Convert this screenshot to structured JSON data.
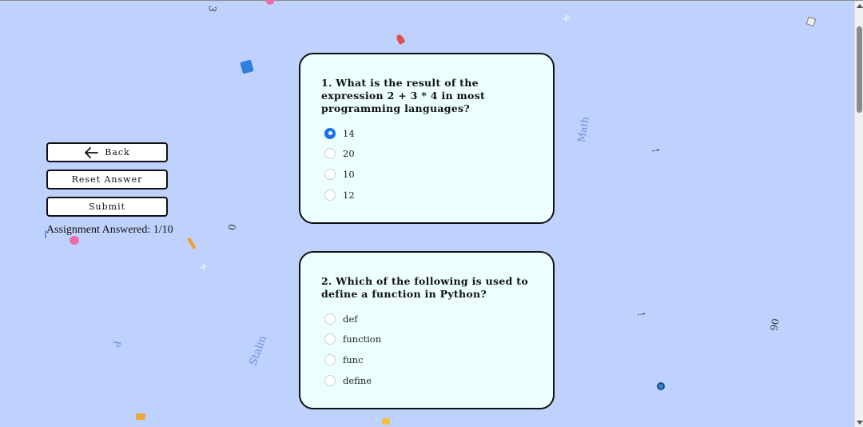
{
  "side_panel": {
    "back_label": "Back",
    "reset_label": "Reset Answer",
    "submit_label": "Submit",
    "answered_text": "Assignment Answered: 1/10"
  },
  "questions": [
    {
      "text": "1. What is the result of the expression 2 + 3 * 4 in most programming languages?",
      "options": [
        "14",
        "20",
        "10",
        "12"
      ],
      "selected_index": 0
    },
    {
      "text": "2. Which of the following is used to define a function in Python?",
      "options": [
        "def",
        "function",
        "func",
        "define"
      ],
      "selected_index": null
    }
  ],
  "background_glyphs": [
    "3",
    "0",
    "P",
    "Stalin",
    "Math",
    "!",
    "!",
    "90",
    "x",
    "x"
  ],
  "colors": {
    "background": "#bfd2fd",
    "card": "#ecfffe",
    "radio_selected": "#1a73e8",
    "glyph": "#6a8fd8"
  }
}
